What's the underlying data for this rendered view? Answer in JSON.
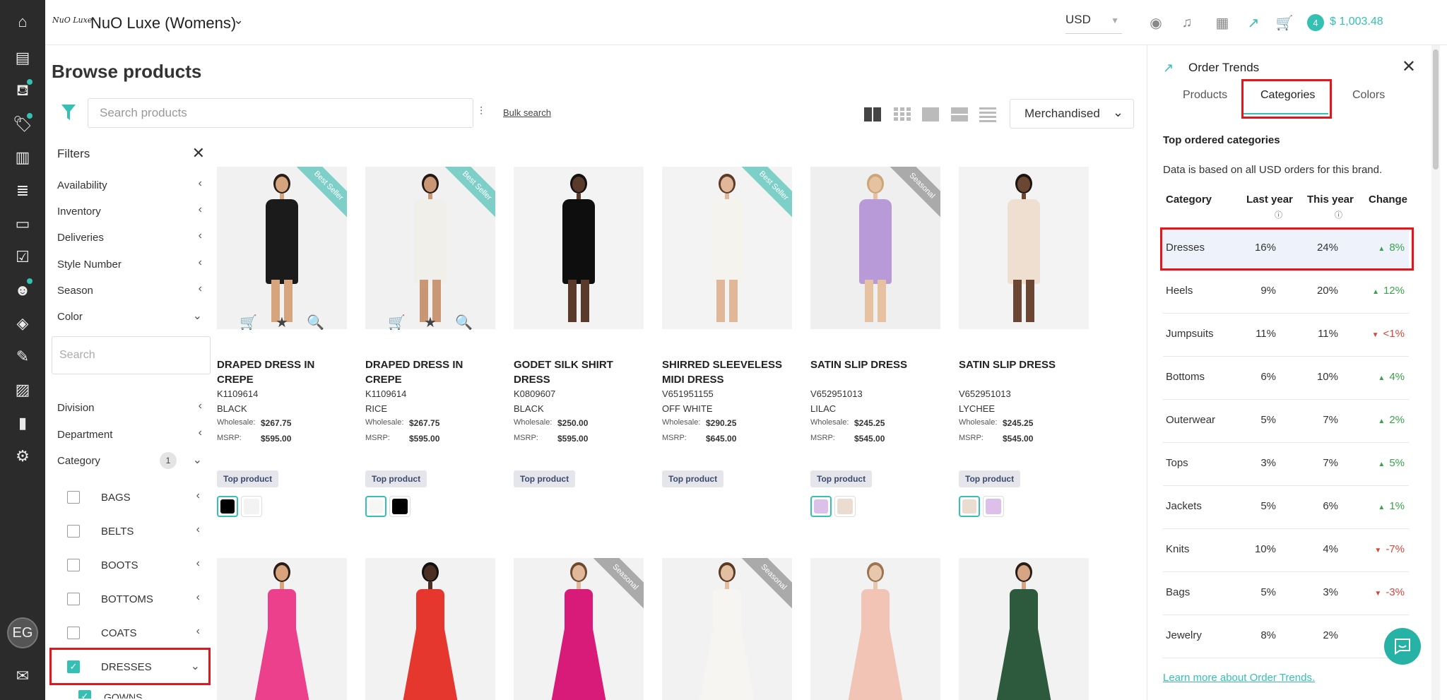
{
  "topbar": {
    "logo_text": "NuO Luxe",
    "brand_name": "NuO Luxe (Womens)",
    "currency": "USD",
    "cart_count": "4",
    "cart_total": "$ 1,003.48"
  },
  "page": {
    "title": "Browse products",
    "search_placeholder": "Search products",
    "bulk_search": "Bulk search",
    "sort": "Merchandised"
  },
  "filters": {
    "title": "Filters",
    "items": [
      "Availability",
      "Inventory",
      "Deliveries",
      "Style Number",
      "Season",
      "Color"
    ],
    "search_placeholder": "Search",
    "items2": [
      "Division",
      "Department",
      "Category"
    ],
    "category_count": "1",
    "categories": [
      {
        "label": "BAGS",
        "checked": false
      },
      {
        "label": "BELTS",
        "checked": false
      },
      {
        "label": "BOOTS",
        "checked": false
      },
      {
        "label": "BOTTOMS",
        "checked": false
      },
      {
        "label": "COATS",
        "checked": false
      },
      {
        "label": "DRESSES",
        "checked": true
      },
      {
        "label": "GOWNS",
        "checked": true
      }
    ]
  },
  "products": [
    {
      "name": "DRAPED DRESS IN CREPE",
      "sku": "K1109614",
      "color": "BLACK",
      "wholesale_label": "Wholesale:",
      "wholesale": "$267.75",
      "msrp_label": "MSRP:",
      "msrp": "$595.00",
      "badge": "Top product",
      "ribbon": "Best Seller",
      "ribbon_color": "#7ecfc7",
      "swatches": [
        "#000000",
        "#f3f3f3"
      ]
    },
    {
      "name": "DRAPED DRESS IN CREPE",
      "sku": "K1109614",
      "color": "RICE",
      "wholesale_label": "Wholesale:",
      "wholesale": "$267.75",
      "msrp_label": "MSRP:",
      "msrp": "$595.00",
      "badge": "Top product",
      "ribbon": "Best Seller",
      "ribbon_color": "#7ecfc7",
      "swatches": [
        "#f6f6f4",
        "#000000"
      ]
    },
    {
      "name": "GODET SILK SHIRT DRESS",
      "sku": "K0809607",
      "color": "BLACK",
      "wholesale_label": "Wholesale:",
      "wholesale": "$250.00",
      "msrp_label": "MSRP:",
      "msrp": "$595.00",
      "badge": "Top product",
      "ribbon": "",
      "swatches": []
    },
    {
      "name": "SHIRRED SLEEVELESS MIDI DRESS",
      "sku": "V651951155",
      "color": "OFF WHITE",
      "wholesale_label": "Wholesale:",
      "wholesale": "$290.25",
      "msrp_label": "MSRP:",
      "msrp": "$645.00",
      "badge": "Top product",
      "ribbon": "Best Seller",
      "ribbon_color": "#7ecfc7",
      "swatches": []
    },
    {
      "name": "SATIN SLIP DRESS",
      "sku": "V652951013",
      "color": "LILAC",
      "wholesale_label": "Wholesale:",
      "wholesale": "$245.25",
      "msrp_label": "MSRP:",
      "msrp": "$545.00",
      "badge": "Top product",
      "ribbon": "Seasonal",
      "ribbon_color": "#aaaaaa",
      "swatches": [
        "#dcc0ea",
        "#eadcd0"
      ]
    },
    {
      "name": "SATIN SLIP DRESS",
      "sku": "V652951013",
      "color": "LYCHEE",
      "wholesale_label": "Wholesale:",
      "wholesale": "$245.25",
      "msrp_label": "MSRP:",
      "msrp": "$545.00",
      "badge": "Top product",
      "ribbon": "",
      "swatches": [
        "#eadcd0",
        "#dcc0ea"
      ]
    }
  ],
  "row2_ribbons": [
    "",
    "",
    "Seasonal",
    "Seasonal",
    "",
    ""
  ],
  "trends": {
    "title": "Order Trends",
    "tabs": [
      "Products",
      "Categories",
      "Colors"
    ],
    "subtitle": "Top ordered categories",
    "note": "Data is based on all USD orders for this brand.",
    "headers": [
      "Category",
      "Last year",
      "This year",
      "Change"
    ],
    "rows": [
      {
        "category": "Dresses",
        "last": "16%",
        "this": "24%",
        "change": "8%",
        "dir": "up"
      },
      {
        "category": "Heels",
        "last": "9%",
        "this": "20%",
        "change": "12%",
        "dir": "up"
      },
      {
        "category": "Jumpsuits",
        "last": "11%",
        "this": "11%",
        "change": "<1%",
        "dir": "down"
      },
      {
        "category": "Bottoms",
        "last": "6%",
        "this": "10%",
        "change": "4%",
        "dir": "up"
      },
      {
        "category": "Outerwear",
        "last": "5%",
        "this": "7%",
        "change": "2%",
        "dir": "up"
      },
      {
        "category": "Tops",
        "last": "3%",
        "this": "7%",
        "change": "5%",
        "dir": "up"
      },
      {
        "category": "Jackets",
        "last": "5%",
        "this": "6%",
        "change": "1%",
        "dir": "up"
      },
      {
        "category": "Knits",
        "last": "10%",
        "this": "4%",
        "change": "-7%",
        "dir": "down"
      },
      {
        "category": "Bags",
        "last": "5%",
        "this": "3%",
        "change": "-3%",
        "dir": "down"
      },
      {
        "category": "Jewelry",
        "last": "8%",
        "this": "2%",
        "change": "",
        "dir": "down"
      }
    ],
    "link": "Learn more about Order Trends."
  },
  "user_initials": "EG",
  "colors": {
    "accent": "#34c1b3",
    "highlight": "#e5161b"
  }
}
